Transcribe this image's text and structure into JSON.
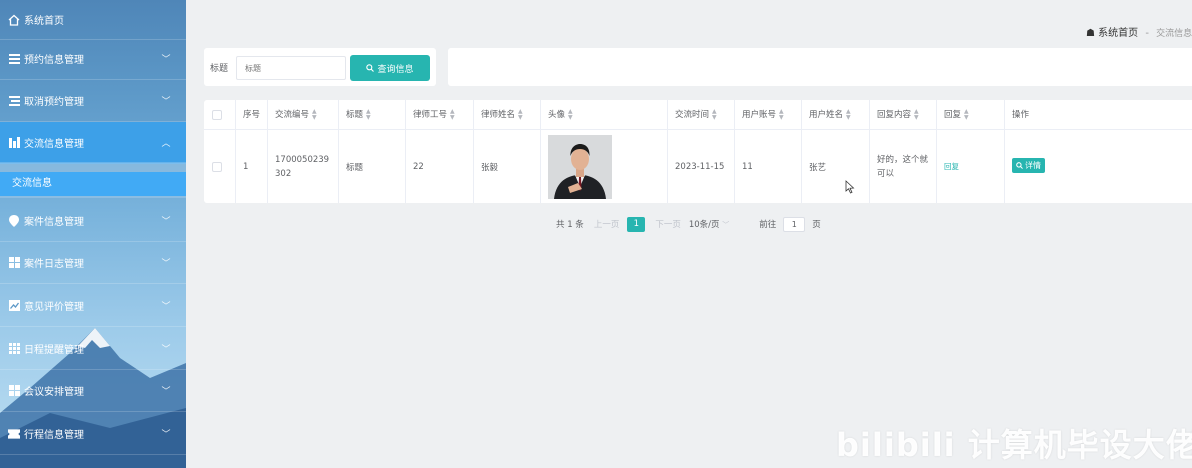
{
  "sidebar": {
    "home": "系统首页",
    "items": [
      {
        "label": "预约信息管理",
        "icon": "list-icon"
      },
      {
        "label": "取消预约管理",
        "icon": "list-icon"
      },
      {
        "label": "交流信息管理",
        "icon": "bar-chart-icon",
        "expanded": true
      },
      {
        "label": "案件信息管理",
        "icon": "location-pin-icon"
      },
      {
        "label": "案件日志管理",
        "icon": "grid-icon"
      },
      {
        "label": "意见评价管理",
        "icon": "trend-icon"
      },
      {
        "label": "日程提醒管理",
        "icon": "grid-icon"
      },
      {
        "label": "会议安排管理",
        "icon": "grid-icon"
      },
      {
        "label": "行程信息管理",
        "icon": "ticket-icon"
      }
    ],
    "sub_item": "交流信息"
  },
  "breadcrumb": {
    "home": "系统首页",
    "separator": "-",
    "current": "交流信息"
  },
  "search": {
    "label": "标题",
    "placeholder": "标题",
    "button": "查询信息"
  },
  "table": {
    "headers": [
      "序号",
      "交流编号",
      "标题",
      "律师工号",
      "律师姓名",
      "头像",
      "交流时间",
      "用户账号",
      "用户姓名",
      "回复内容",
      "回复",
      "操作"
    ],
    "rows": [
      {
        "index": "1",
        "code": "1700050239302",
        "title": "标题",
        "lawyer_no": "22",
        "lawyer_name": "张毅",
        "time": "2023-11-15",
        "user_account": "11",
        "user_name": "张艺",
        "reply_content": "好的，这个就可以",
        "reply_link": "回复",
        "action": "详情"
      }
    ]
  },
  "pagination": {
    "total": "共 1 条",
    "prev": "上一页",
    "page": "1",
    "next": "下一页",
    "page_size": "10条/页",
    "goto_label": "前往",
    "goto_value": "1",
    "goto_suffix": "页"
  },
  "watermark": "bilibili 计算机毕设大佬",
  "colors": {
    "accent": "#27b5b0",
    "sidebar_active": "#3da0e8",
    "sub_item": "#41aaf5"
  }
}
